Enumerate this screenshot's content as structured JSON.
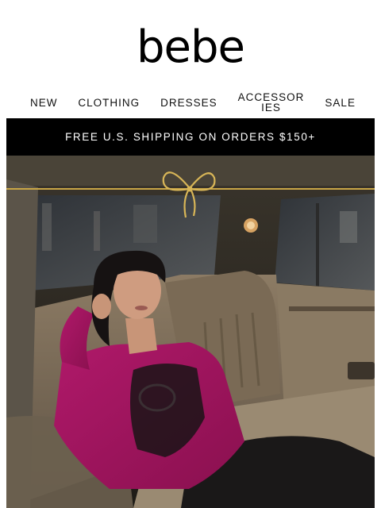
{
  "brand": {
    "logo_text": "bebe"
  },
  "nav": {
    "items": [
      {
        "label": "NEW"
      },
      {
        "label": "CLOTHING"
      },
      {
        "label": "DRESSES"
      },
      {
        "label": "ACCESSORIES"
      },
      {
        "label": "SALE"
      }
    ]
  },
  "promo": {
    "text": "FREE U.S. SHIPPING ON ORDERS $150+"
  },
  "hero": {
    "image_subject": "model-in-magenta-blazer-in-car",
    "ribbon_color": "#c9a646",
    "blazer_color": "#a3155f"
  }
}
